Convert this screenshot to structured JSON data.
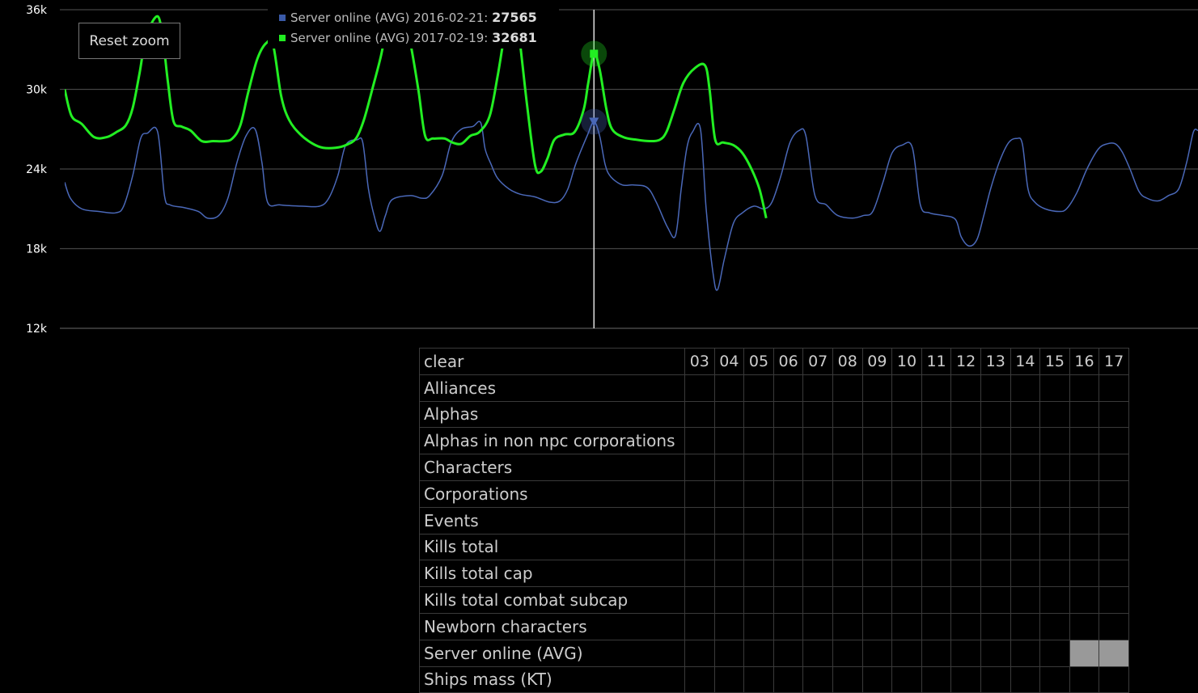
{
  "reset_zoom_label": "Reset zoom",
  "tooltip": [
    {
      "label": "Server online (AVG) 2016-02-21: ",
      "value": "27565",
      "color": "#3a5aa8"
    },
    {
      "label": "Server online (AVG) 2017-02-19: ",
      "value": "32681",
      "color": "#22ee22"
    }
  ],
  "chart_data": {
    "type": "line",
    "y_ticks": [
      "36k",
      "30k",
      "24k",
      "18k",
      "12k"
    ],
    "ylim": [
      12000,
      36000
    ],
    "x_range": [
      0,
      100
    ],
    "series": [
      {
        "color": "#4a68b8",
        "values": [
          [
            0,
            23000
          ],
          [
            0.5,
            21800
          ],
          [
            1.5,
            21000
          ],
          [
            3,
            20800
          ],
          [
            4.5,
            20700
          ],
          [
            5.2,
            21200
          ],
          [
            6,
            23500
          ],
          [
            6.7,
            26300
          ],
          [
            7.3,
            26700
          ],
          [
            8.2,
            26800
          ],
          [
            8.8,
            22000
          ],
          [
            9.3,
            21300
          ],
          [
            10.5,
            21100
          ],
          [
            11.8,
            20800
          ],
          [
            12.6,
            20300
          ],
          [
            13.6,
            20500
          ],
          [
            14.4,
            21800
          ],
          [
            15.2,
            24500
          ],
          [
            16,
            26500
          ],
          [
            16.8,
            27000
          ],
          [
            17.4,
            24500
          ],
          [
            17.9,
            21500
          ],
          [
            19,
            21300
          ],
          [
            21,
            21200
          ],
          [
            22.5,
            21200
          ],
          [
            23.3,
            21800
          ],
          [
            24.1,
            23500
          ],
          [
            24.8,
            25800
          ],
          [
            25.8,
            26200
          ],
          [
            26.3,
            26000
          ],
          [
            26.8,
            22500
          ],
          [
            27.3,
            20500
          ],
          [
            27.8,
            19300
          ],
          [
            28.3,
            20500
          ],
          [
            28.9,
            21700
          ],
          [
            30.5,
            22000
          ],
          [
            31.5,
            21800
          ],
          [
            32.2,
            22000
          ],
          [
            33.3,
            23500
          ],
          [
            34.1,
            26000
          ],
          [
            35,
            27000
          ],
          [
            36,
            27200
          ],
          [
            36.7,
            27500
          ],
          [
            37.1,
            25500
          ],
          [
            37.6,
            24400
          ],
          [
            38.2,
            23300
          ],
          [
            39.2,
            22500
          ],
          [
            40.2,
            22100
          ],
          [
            41.5,
            21900
          ],
          [
            42.8,
            21500
          ],
          [
            43.7,
            21600
          ],
          [
            44.4,
            22500
          ],
          [
            45.1,
            24400
          ],
          [
            46.1,
            26500
          ],
          [
            46.7,
            27565
          ],
          [
            47.2,
            26500
          ],
          [
            47.7,
            24300
          ],
          [
            48.2,
            23400
          ],
          [
            49.2,
            22800
          ],
          [
            50.2,
            22800
          ],
          [
            51.4,
            22600
          ],
          [
            52.2,
            21500
          ],
          [
            53.2,
            19600
          ],
          [
            53.9,
            19000
          ],
          [
            54.4,
            22500
          ],
          [
            54.9,
            25600
          ],
          [
            55.4,
            26800
          ],
          [
            56.1,
            27000
          ],
          [
            56.6,
            21000
          ],
          [
            57.2,
            16200
          ],
          [
            57.6,
            14900
          ],
          [
            58.2,
            17200
          ],
          [
            59,
            19900
          ],
          [
            59.8,
            20700
          ],
          [
            60.8,
            21200
          ],
          [
            61.7,
            21000
          ],
          [
            62.4,
            21500
          ],
          [
            63.2,
            23500
          ],
          [
            64,
            26000
          ],
          [
            64.8,
            26900
          ],
          [
            65.4,
            26500
          ],
          [
            66.2,
            22000
          ],
          [
            67.2,
            21300
          ],
          [
            68.2,
            20500
          ],
          [
            69.5,
            20300
          ],
          [
            70.5,
            20500
          ],
          [
            71.3,
            20800
          ],
          [
            72.2,
            23000
          ],
          [
            73,
            25200
          ],
          [
            73.9,
            25800
          ],
          [
            74.8,
            25600
          ],
          [
            75.5,
            21300
          ],
          [
            76.3,
            20700
          ],
          [
            77.5,
            20500
          ],
          [
            78.6,
            20200
          ],
          [
            79.1,
            18900
          ],
          [
            79.8,
            18200
          ],
          [
            80.5,
            18700
          ],
          [
            81.1,
            20500
          ],
          [
            81.7,
            22500
          ],
          [
            82.5,
            24600
          ],
          [
            83.3,
            26000
          ],
          [
            84,
            26300
          ],
          [
            84.5,
            25900
          ],
          [
            85,
            22500
          ],
          [
            85.6,
            21500
          ],
          [
            86.5,
            21000
          ],
          [
            87.7,
            20800
          ],
          [
            88.4,
            21000
          ],
          [
            89.3,
            22200
          ],
          [
            90.2,
            24000
          ],
          [
            91.2,
            25500
          ],
          [
            92,
            25900
          ],
          [
            92.7,
            25900
          ],
          [
            93.3,
            25300
          ],
          [
            94,
            24000
          ],
          [
            94.8,
            22300
          ],
          [
            95.5,
            21800
          ],
          [
            96.5,
            21600
          ],
          [
            97.4,
            22000
          ],
          [
            98.3,
            22500
          ],
          [
            99,
            24500
          ],
          [
            99.6,
            26800
          ],
          [
            100,
            26900
          ]
        ]
      },
      {
        "color": "#22ee22",
        "values": [
          [
            0,
            30000
          ],
          [
            0.6,
            28000
          ],
          [
            1.5,
            27400
          ],
          [
            2.6,
            26400
          ],
          [
            3.7,
            26400
          ],
          [
            4.6,
            26800
          ],
          [
            5.4,
            27300
          ],
          [
            6,
            28600
          ],
          [
            6.6,
            31200
          ],
          [
            7.2,
            34000
          ],
          [
            8.2,
            35500
          ],
          [
            8.7,
            33500
          ],
          [
            9.1,
            30600
          ],
          [
            9.6,
            27600
          ],
          [
            10.3,
            27200
          ],
          [
            11.1,
            26900
          ],
          [
            12.1,
            26100
          ],
          [
            13.1,
            26100
          ],
          [
            14.1,
            26100
          ],
          [
            14.8,
            26300
          ],
          [
            15.5,
            27300
          ],
          [
            16.2,
            29800
          ],
          [
            17,
            32300
          ],
          [
            17.8,
            33500
          ],
          [
            18.4,
            33300
          ],
          [
            19.1,
            29500
          ],
          [
            19.8,
            27700
          ],
          [
            20.8,
            26600
          ],
          [
            21.9,
            25900
          ],
          [
            22.8,
            25600
          ],
          [
            23.9,
            25600
          ],
          [
            24.8,
            25800
          ],
          [
            25.7,
            26300
          ],
          [
            26.4,
            27700
          ],
          [
            27.2,
            30200
          ],
          [
            27.9,
            32500
          ],
          [
            28.5,
            35000
          ],
          [
            29.1,
            36500
          ],
          [
            29.9,
            35500
          ],
          [
            30.5,
            33500
          ],
          [
            31.2,
            30000
          ],
          [
            31.8,
            26500
          ],
          [
            32.5,
            26300
          ],
          [
            33.5,
            26300
          ],
          [
            34.2,
            26000
          ],
          [
            35,
            25900
          ],
          [
            35.8,
            26500
          ],
          [
            36.6,
            26800
          ],
          [
            37.5,
            28000
          ],
          [
            38.2,
            31000
          ],
          [
            38.9,
            34500
          ],
          [
            39.6,
            36500
          ],
          [
            40.1,
            34000
          ],
          [
            40.8,
            28800
          ],
          [
            41.5,
            24300
          ],
          [
            42,
            23800
          ],
          [
            42.6,
            24800
          ],
          [
            43.2,
            26200
          ],
          [
            44.1,
            26600
          ],
          [
            45,
            26800
          ],
          [
            45.8,
            28500
          ],
          [
            46.2,
            30500
          ],
          [
            46.7,
            32681
          ],
          [
            47.2,
            31500
          ],
          [
            47.8,
            28500
          ],
          [
            48.3,
            27000
          ],
          [
            49.3,
            26400
          ],
          [
            50.5,
            26200
          ],
          [
            51.6,
            26100
          ],
          [
            52.5,
            26200
          ],
          [
            53.1,
            26800
          ],
          [
            53.8,
            28500
          ],
          [
            54.6,
            30500
          ],
          [
            55.6,
            31600
          ],
          [
            56.5,
            31800
          ],
          [
            56.9,
            30000
          ],
          [
            57.4,
            26200
          ],
          [
            58.1,
            26000
          ],
          [
            59,
            25800
          ],
          [
            59.8,
            25200
          ],
          [
            60.6,
            24000
          ],
          [
            61.3,
            22500
          ],
          [
            61.9,
            20300
          ]
        ]
      }
    ],
    "hover_x": 46.7
  },
  "table": {
    "header_label": "clear",
    "columns": [
      "03",
      "04",
      "05",
      "06",
      "07",
      "08",
      "09",
      "10",
      "11",
      "12",
      "13",
      "14",
      "15",
      "16",
      "17"
    ],
    "rows": [
      {
        "name": "Alliances",
        "on": []
      },
      {
        "name": "Alphas",
        "on": []
      },
      {
        "name": "Alphas in non npc corporations",
        "on": []
      },
      {
        "name": "Characters",
        "on": []
      },
      {
        "name": "Corporations",
        "on": []
      },
      {
        "name": "Events",
        "on": []
      },
      {
        "name": "Kills total",
        "on": []
      },
      {
        "name": "Kills total cap",
        "on": []
      },
      {
        "name": "Kills total combat subcap",
        "on": []
      },
      {
        "name": "Newborn characters",
        "on": []
      },
      {
        "name": "Server online (AVG)",
        "on": [
          "16",
          "17"
        ]
      },
      {
        "name": "Ships mass (KT)",
        "on": []
      }
    ]
  }
}
